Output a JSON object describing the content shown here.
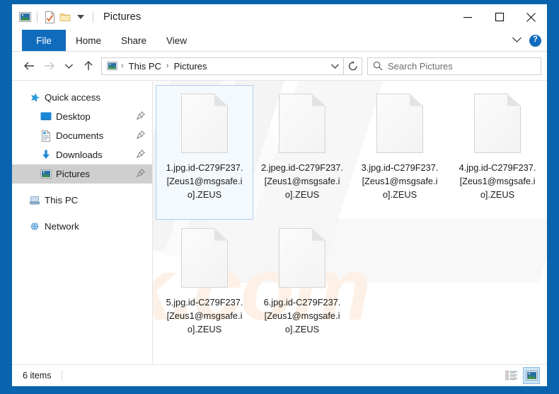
{
  "window": {
    "title": "Pictures",
    "quick_access_icons": [
      "pictures-icon",
      "properties-icon",
      "new-folder-icon",
      "customize-dropdown-icon"
    ],
    "controls": {
      "minimize": "minimize-button",
      "maximize": "maximize-button",
      "close": "close-button"
    }
  },
  "ribbon": {
    "tabs": [
      {
        "label": "File",
        "active": true
      },
      {
        "label": "Home",
        "active": false
      },
      {
        "label": "Share",
        "active": false
      },
      {
        "label": "View",
        "active": false
      }
    ],
    "collapse_icon": "chevron-down-icon",
    "help_label": "?"
  },
  "navbar": {
    "back": "back-arrow-icon",
    "forward": "forward-arrow-icon",
    "recent": "chevron-down-icon",
    "up": "up-arrow-icon",
    "refresh": "refresh-icon",
    "breadcrumb": [
      "This PC",
      "Pictures"
    ],
    "breadcrumb_separator": "›",
    "address_dropdown": "chevron-down-icon"
  },
  "search": {
    "placeholder": "Search Pictures",
    "value": "",
    "icon": "search-icon"
  },
  "sidebar": {
    "items": [
      {
        "label": "Quick access",
        "icon": "star-icon",
        "level": 0,
        "pinned": false,
        "selected": false
      },
      {
        "label": "Desktop",
        "icon": "desktop-icon",
        "level": 1,
        "pinned": true,
        "selected": false
      },
      {
        "label": "Documents",
        "icon": "documents-icon",
        "level": 1,
        "pinned": true,
        "selected": false
      },
      {
        "label": "Downloads",
        "icon": "downloads-icon",
        "level": 1,
        "pinned": true,
        "selected": false
      },
      {
        "label": "Pictures",
        "icon": "pictures-icon",
        "level": 1,
        "pinned": true,
        "selected": true
      },
      {
        "label": "This PC",
        "icon": "this-pc-icon",
        "level": 0,
        "pinned": false,
        "selected": false
      },
      {
        "label": "Network",
        "icon": "network-icon",
        "level": 0,
        "pinned": false,
        "selected": false
      }
    ],
    "pin_icon": "pin-icon"
  },
  "files": [
    {
      "name": "1.jpg.id-C279F237.[Zeus1@msgsafe.io].ZEUS",
      "icon": "generic-file-icon",
      "selected": true
    },
    {
      "name": "2.jpeg.id-C279F237.[Zeus1@msgsafe.io].ZEUS",
      "icon": "generic-file-icon",
      "selected": false
    },
    {
      "name": "3.jpg.id-C279F237.[Zeus1@msgsafe.io].ZEUS",
      "icon": "generic-file-icon",
      "selected": false
    },
    {
      "name": "4.jpg.id-C279F237.[Zeus1@msgsafe.io].ZEUS",
      "icon": "generic-file-icon",
      "selected": false
    },
    {
      "name": "5.jpg.id-C279F237.[Zeus1@msgsafe.io].ZEUS",
      "icon": "generic-file-icon",
      "selected": false
    },
    {
      "name": "6.jpg.id-C279F237.[Zeus1@msgsafe.io].ZEUS",
      "icon": "generic-file-icon",
      "selected": false
    }
  ],
  "statusbar": {
    "item_count": "6 items",
    "views": [
      {
        "name": "details-view-button",
        "active": false
      },
      {
        "name": "large-icons-view-button",
        "active": true
      }
    ]
  },
  "watermark": {
    "text": "risk.com",
    "color": "#fdf1e7"
  },
  "colors": {
    "accent": "#0a64ad",
    "tab_active": "#0f6cbd",
    "selection_border": "#a9d1f2",
    "selection_fill": "#f4f9fe",
    "sidebar_selected": "#cfcfcf"
  }
}
